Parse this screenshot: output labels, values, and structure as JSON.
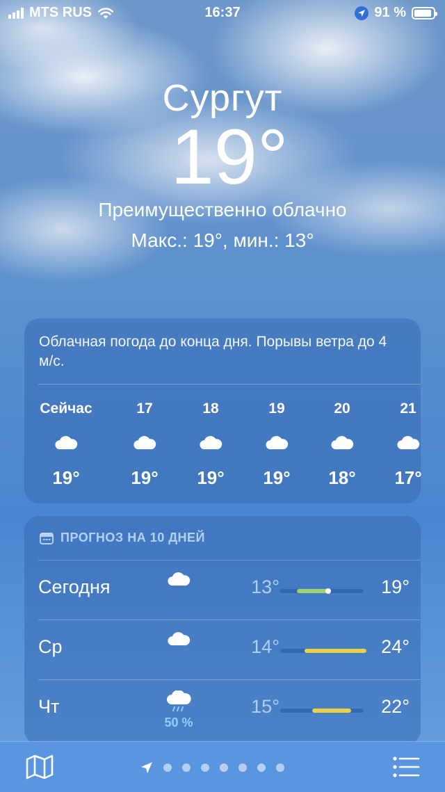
{
  "status": {
    "carrier": "MTS RUS",
    "time": "16:37",
    "battery": "91 %",
    "battery_level": 0.91
  },
  "current": {
    "city": "Сургут",
    "temperature": "19°",
    "condition": "Преимущественно облачно",
    "hilo": "Макс.: 19°, мин.: 13°"
  },
  "hourly": {
    "summary": "Облачная погода до конца дня. Порывы ветра до 4 м/с.",
    "items": [
      {
        "label": "Сейчас",
        "icon": "cloud-icon",
        "temp": "19°"
      },
      {
        "label": "17",
        "icon": "cloud-icon",
        "temp": "19°"
      },
      {
        "label": "18",
        "icon": "cloud-icon",
        "temp": "19°"
      },
      {
        "label": "19",
        "icon": "cloud-icon",
        "temp": "19°"
      },
      {
        "label": "20",
        "icon": "cloud-icon",
        "temp": "18°"
      },
      {
        "label": "21",
        "icon": "cloud-icon",
        "temp": "17°"
      }
    ]
  },
  "forecast": {
    "header": "ПРОГНОЗ НА 10 ДНЕЙ",
    "header_icon": "calendar-icon",
    "range_min": 13,
    "range_max": 24,
    "days": [
      {
        "name": "Сегодня",
        "icon": "cloud-icon",
        "precip": "",
        "low": "13°",
        "high": "19°",
        "low_val": 13,
        "high_val": 19,
        "current_val": 19,
        "color": "#9ed36a"
      },
      {
        "name": "Ср",
        "icon": "cloud-icon",
        "precip": "",
        "low": "14°",
        "high": "24°",
        "low_val": 14,
        "high_val": 24,
        "color": "#e8d24a"
      },
      {
        "name": "Чт",
        "icon": "cloud-rain-icon",
        "precip": "50 %",
        "low": "15°",
        "high": "22°",
        "low_val": 15,
        "high_val": 22,
        "color": "#e8d24a"
      }
    ]
  },
  "toolbar": {
    "map_icon": "map-icon",
    "location_icon": "location-arrow-icon",
    "page_count": 7,
    "list_icon": "list-icon"
  }
}
